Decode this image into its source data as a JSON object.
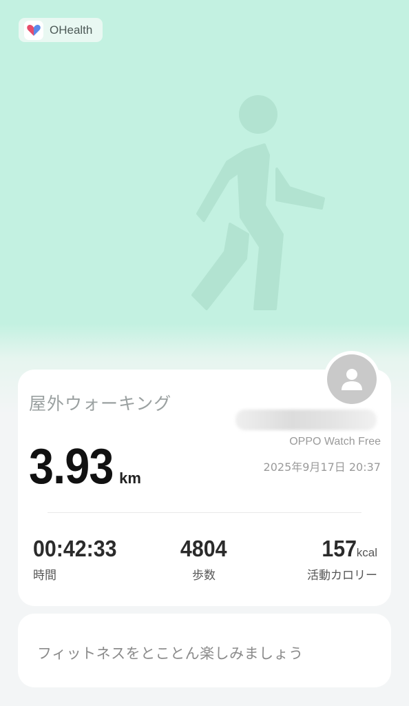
{
  "app": {
    "name": "OHealth",
    "icon": "heart-icon",
    "colors": {
      "heart_left": "#e74c6a",
      "heart_right": "#4a7de8"
    }
  },
  "hero": {
    "icon": "walking-person-icon",
    "background": "#c3f1e1"
  },
  "workout": {
    "title": "屋外ウォーキング",
    "distance_value": "3.93",
    "distance_unit": "km",
    "device": "OPPO Watch Free",
    "datetime": "2025年9月17日 20:37",
    "avatar_icon": "user-avatar-icon"
  },
  "stats": {
    "duration": {
      "value": "00:42:33",
      "label": "時間"
    },
    "steps": {
      "value": "4804",
      "label": "歩数"
    },
    "calories": {
      "value": "157",
      "unit": "kcal",
      "label": "活動カロリー"
    }
  },
  "slogan": "フィットネスをとことん楽しみましょう"
}
